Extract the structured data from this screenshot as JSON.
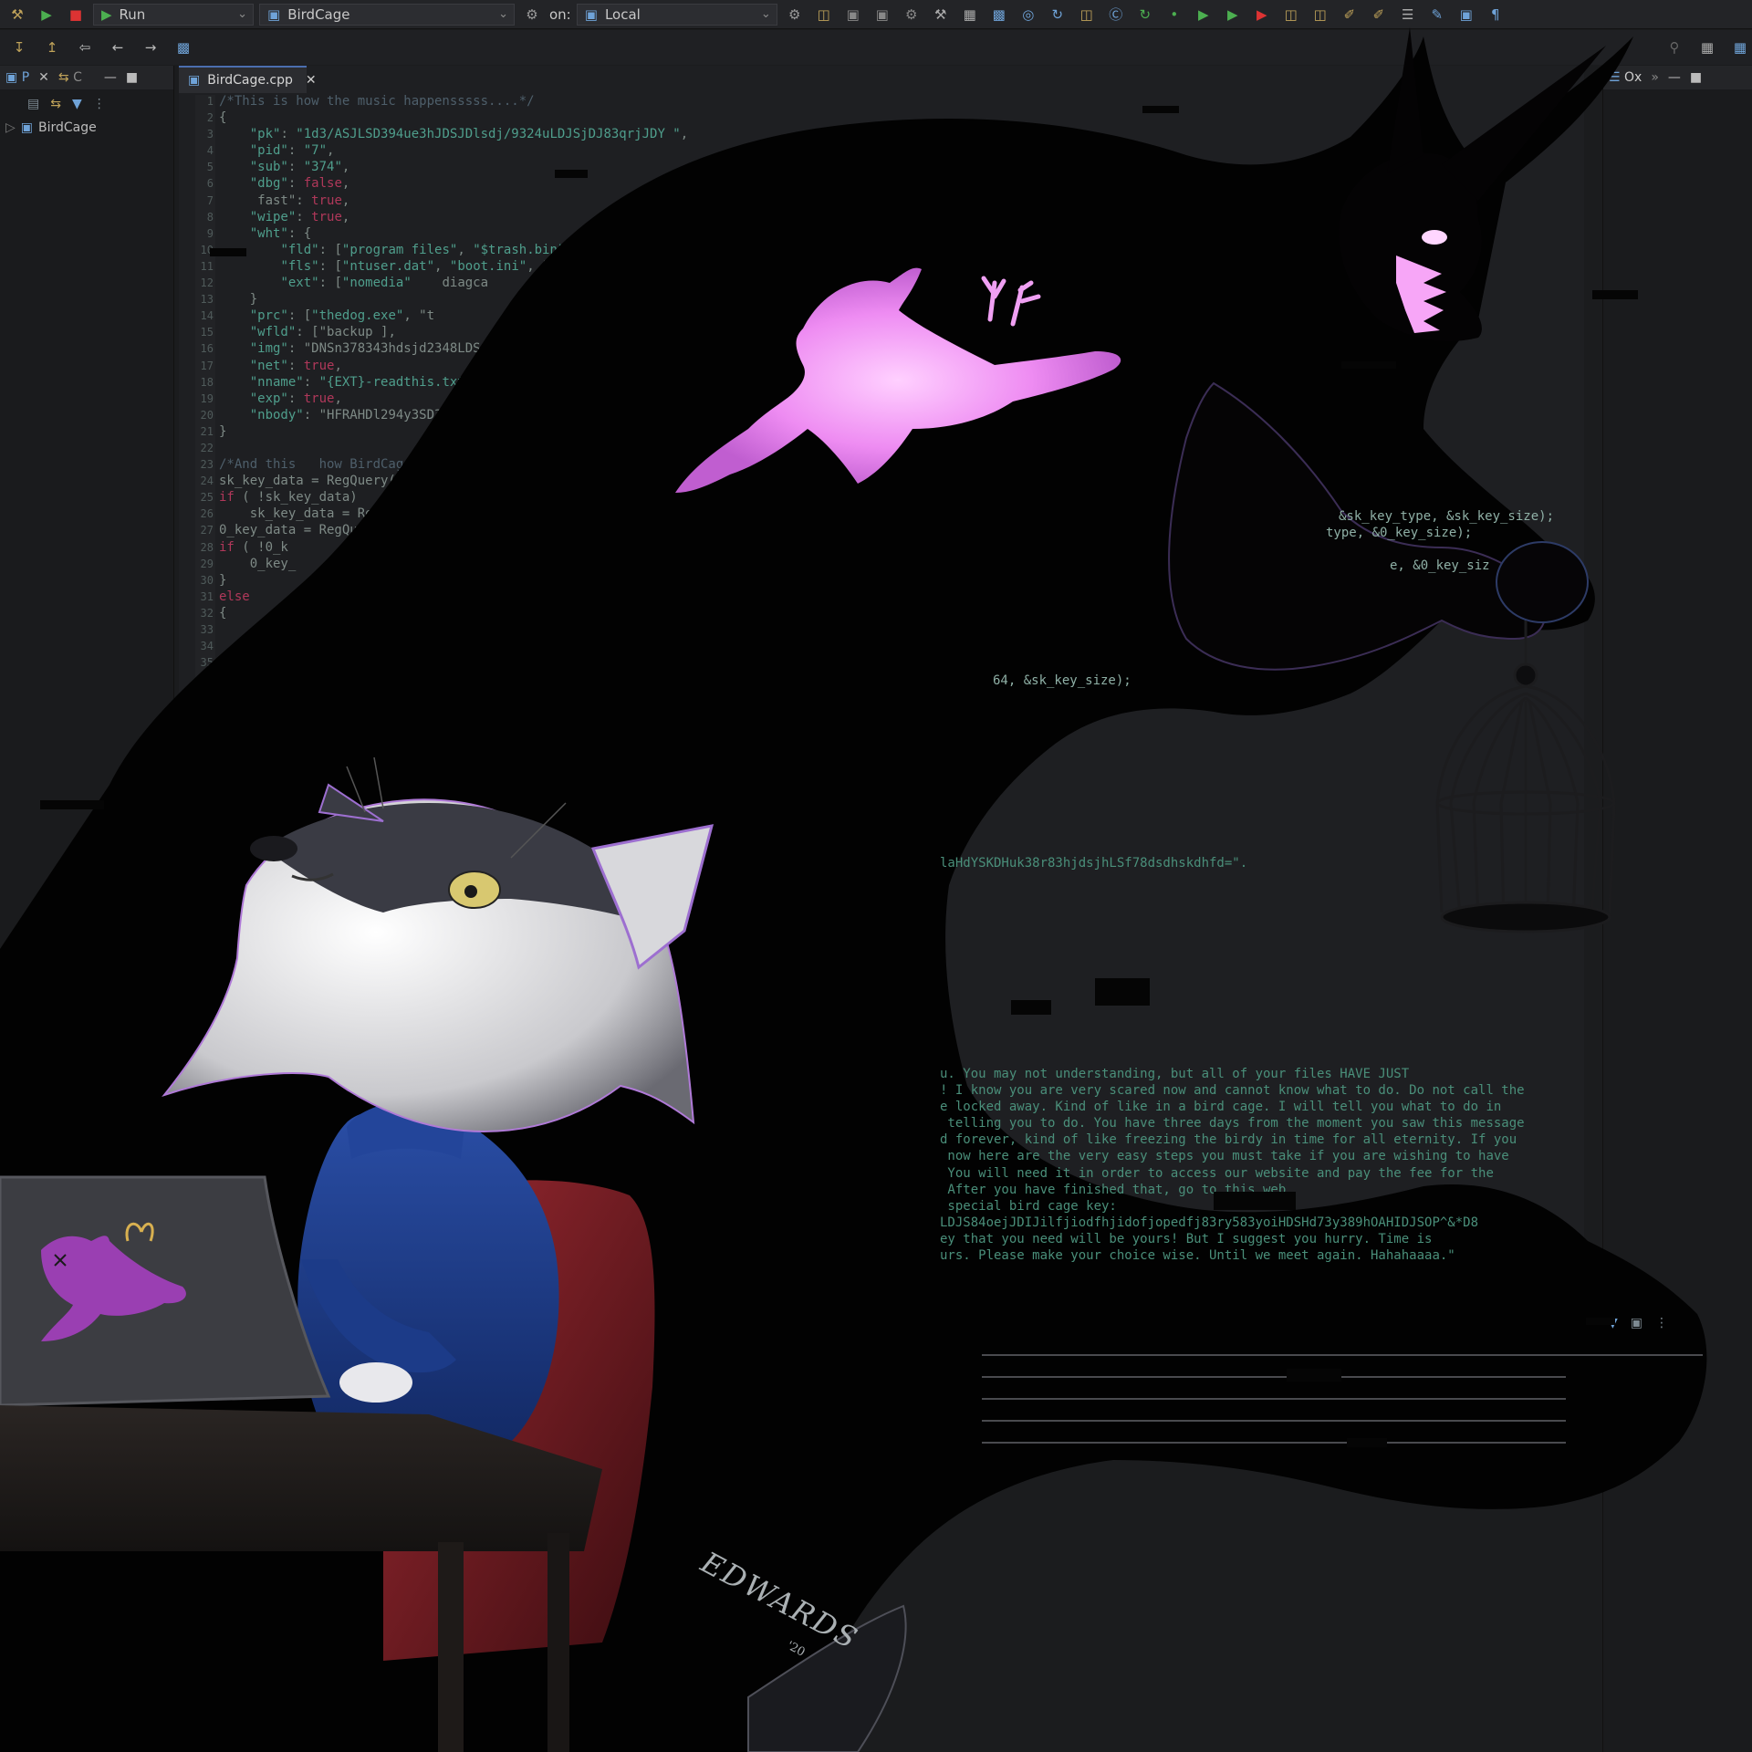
{
  "toolbar": {
    "run_config": "Run",
    "target_label": "BirdCage",
    "on_label": "on:",
    "host_label": "Local"
  },
  "left_pane": {
    "tab_label": "P",
    "tab2_label": "C",
    "tree_item": "BirdCage"
  },
  "editor": {
    "tab_label": "BirdCage.cpp",
    "line_numbers": "1\n2\n3\n4\n5\n6\n7\n8\n9\n10\n11\n12\n13\n14\n15\n16\n17\n18\n19\n20\n21\n22\n23\n24\n25\n26\n27\n28\n29\n30\n31\n32\n33\n34\n35\n36",
    "code_lines": [
      "/*This is how the music happensssss....*/",
      "{",
      "    \"pk\": \"1d3/ASJLSD394ue3hJDSJDlsdj/9324uLDJSjDJ83qrjJDY \",",
      "    \"pid\": \"7\",",
      "    \"sub\": \"374\",",
      "    \"dbg\": false,",
      "     fast\": true,",
      "    \"wipe\": true,",
      "    \"wht\": {",
      "        \"fld\": [\"program files\", \"$trash.bin\"",
      "        \"fls\": [\"ntuser.dat\", \"boot.ini\", \"a",
      "        \"ext\": [\"nomedia\"    diagca",
      "    }",
      "    \"prc\": [\"thedog.exe\", \"t",
      "    \"wfld\": [\"backup ],",
      "    \"img\": \"DNSn378343hdsjd2348LDSJ",
      "    \"net\": true,",
      "    \"nname\": \"{EXT}-readthis.txt\",",
      "    \"exp\": true,",
      "    \"nbody\": \"HFRAHDl294y3SD3H",
      "}",
      "",
      "/*And this   how BirdCage w",
      "sk_key_data = RegQuery(HKEY",
      "if ( !sk_key_data)",
      "    sk_key_data = Reg",
      "0_key_data = RegQuer",
      "if ( !0_k",
      "    0_key_",
      "}",
      "else",
      "{"
    ]
  },
  "code_fragments": {
    "line24_tail": "&sk_key_type, &sk_key_size);",
    "line25_tail": "type, &0_key_size);",
    "line27_tail": "e, &0_key_siz",
    "line36_tail": "64, &sk_key_size);",
    "nbody_tail": "laHdYSKDHuk38r83hjdsjhLSf78dsdhskdhfd=\"."
  },
  "console": {
    "lines": [
      "u. You may not understanding, but all of your files HAVE JUST",
      "! I know you are very scared now and cannot know what to do. Do not call the",
      "e locked away. Kind of like in a bird cage. I will tell you what to do in",
      " telling you to do. You have three days from the moment you saw this message",
      "d forever, kind of like freezing the birdy in time for all eternity. If you",
      " now here are the very easy steps you must take if you are wishing to have",
      " You will need it in order to access our website and pay the fee for the",
      " After you have finished that, go to this web",
      " special bird cage key:",
      "LDJS84oejJDIJilfjiodfhjidofjopedfj83ry583yoiHDSHd73y389hOAHIDJSOP^&*D8",
      "ey that you need will be yours! But I suggest you hurry. Time is",
      "urs. Please make your choice wise. Until we meet again. Hahahaaaa.\""
    ]
  },
  "right_pane": {
    "tab_label": "Ox"
  },
  "signature": {
    "name": "EDWARDS",
    "year": "'20"
  },
  "colors": {
    "ide_bg": "#1e1f22",
    "string": "#4f9e8c",
    "keyword": "#b0385a",
    "glow_pink": "#ee8cf2",
    "sweater": "#1f3f8c",
    "chair": "#7a1a22"
  }
}
